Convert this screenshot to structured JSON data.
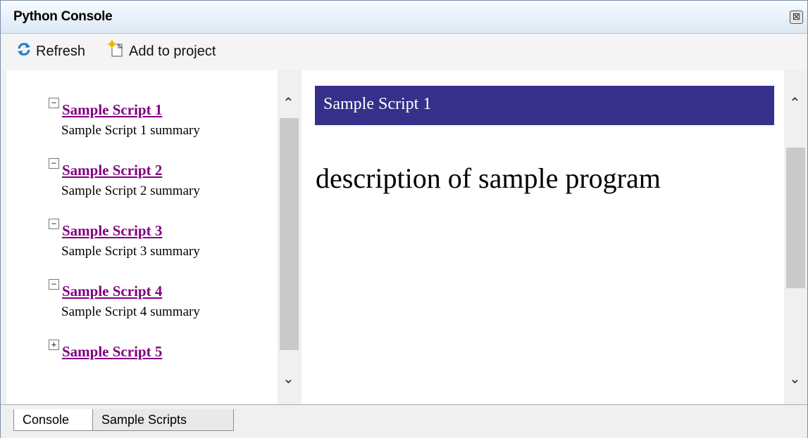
{
  "window": {
    "title": "Python Console",
    "close_glyph": "⊠"
  },
  "toolbar": {
    "refresh_label": "Refresh",
    "add_label": "Add to project",
    "refresh_icon": "refresh-icon",
    "add_icon": "new-file-icon"
  },
  "scripts": [
    {
      "title": "Sample Script 1",
      "summary": "Sample Script 1 summary",
      "expanded": true
    },
    {
      "title": "Sample Script 2",
      "summary": "Sample Script 2 summary",
      "expanded": true
    },
    {
      "title": "Sample Script 3",
      "summary": "Sample Script 3 summary",
      "expanded": true
    },
    {
      "title": "Sample Script 4",
      "summary": "Sample Script 4 summary",
      "expanded": true
    },
    {
      "title": "Sample Script 5",
      "summary": "",
      "expanded": false
    }
  ],
  "detail": {
    "title": "Sample Script 1",
    "description": "description of sample program"
  },
  "tabs": [
    {
      "label": "Console"
    },
    {
      "label": "Sample Scripts"
    }
  ],
  "colors": {
    "header_bg": "#36308a",
    "link": "#800080"
  }
}
